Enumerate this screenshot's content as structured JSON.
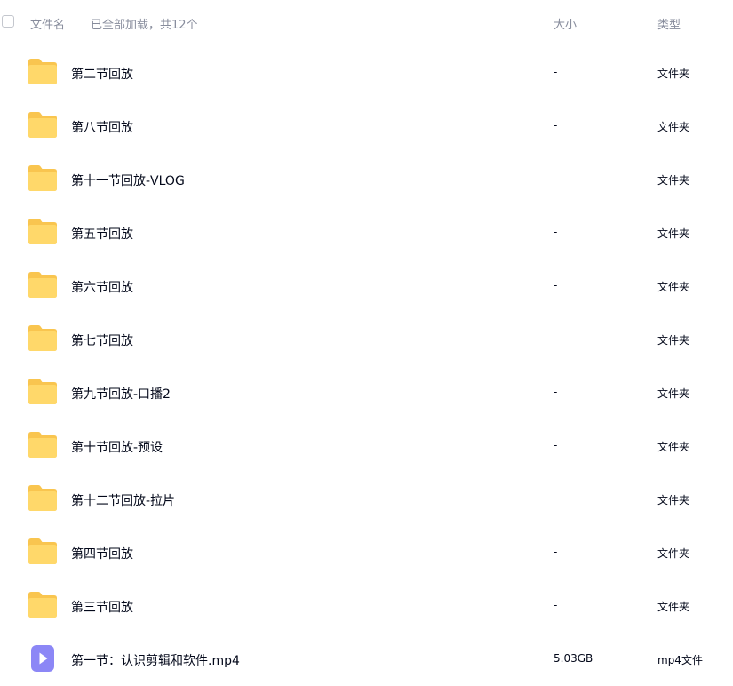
{
  "header": {
    "col_name": "文件名",
    "loaded_status": "已全部加载，共12个",
    "col_size": "大小",
    "col_type": "类型"
  },
  "colors": {
    "folder_back": "#f9c54f",
    "folder_front": "#ffd86a",
    "video_icon": "#8c87f6"
  },
  "files": [
    {
      "name": "第二节回放",
      "size": "-",
      "type": "文件夹",
      "icon": "folder-icon"
    },
    {
      "name": "第八节回放",
      "size": "-",
      "type": "文件夹",
      "icon": "folder-icon"
    },
    {
      "name": "第十一节回放-VLOG",
      "size": "-",
      "type": "文件夹",
      "icon": "folder-icon"
    },
    {
      "name": "第五节回放",
      "size": "-",
      "type": "文件夹",
      "icon": "folder-icon"
    },
    {
      "name": "第六节回放",
      "size": "-",
      "type": "文件夹",
      "icon": "folder-icon"
    },
    {
      "name": "第七节回放",
      "size": "-",
      "type": "文件夹",
      "icon": "folder-icon"
    },
    {
      "name": "第九节回放-口播2",
      "size": "-",
      "type": "文件夹",
      "icon": "folder-icon"
    },
    {
      "name": "第十节回放-预设",
      "size": "-",
      "type": "文件夹",
      "icon": "folder-icon"
    },
    {
      "name": "第十二节回放-拉片",
      "size": "-",
      "type": "文件夹",
      "icon": "folder-icon"
    },
    {
      "name": "第四节回放",
      "size": "-",
      "type": "文件夹",
      "icon": "folder-icon"
    },
    {
      "name": "第三节回放",
      "size": "-",
      "type": "文件夹",
      "icon": "folder-icon"
    },
    {
      "name": "第一节：认识剪辑和软件.mp4",
      "size": "5.03GB",
      "type": "mp4文件",
      "icon": "video-file-icon"
    }
  ]
}
